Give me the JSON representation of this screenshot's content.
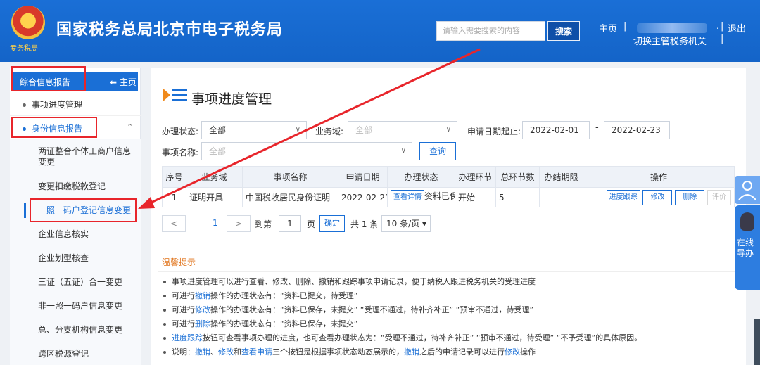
{
  "header": {
    "emblem_text": "专务税局",
    "title": "国家税务总局北京市电子税务局",
    "search_placeholder": "请输入需要搜索的内容",
    "search_button": "搜索",
    "home_link": "主页",
    "separator": "|",
    "dot": ".",
    "logout": "退出",
    "switch_authority": "切换主管税务机关"
  },
  "sidebar": {
    "section_title": "综合信息报告",
    "home_label": "主页",
    "items": [
      {
        "label": "事项进度管理"
      },
      {
        "label": "身份信息报告"
      }
    ],
    "subitems": [
      {
        "label": "两证整合个体工商户信息变更"
      },
      {
        "label": "变更扣缴税款登记"
      },
      {
        "label": "一照一码户登记信息变更"
      },
      {
        "label": "企业信息核实"
      },
      {
        "label": "企业划型核查"
      },
      {
        "label": "三证（五证）合一变更"
      },
      {
        "label": "非一照一码户信息变更"
      },
      {
        "label": "总、分支机构信息变更"
      },
      {
        "label": "跨区税源登记"
      }
    ]
  },
  "main": {
    "page_title": "事项进度管理",
    "filters": {
      "status_label": "办理状态:",
      "status_value": "全部",
      "domain_label": "业务域:",
      "domain_value": "全部",
      "date_label": "申请日期起止:",
      "date_from": "2022-02-01",
      "date_dash": "-",
      "date_to": "2022-02-23",
      "name_label": "事项名称:",
      "name_value": "全部",
      "query_button": "查询"
    },
    "table": {
      "headers": [
        "序号",
        "业务域",
        "事项名称",
        "申请日期",
        "办理状态",
        "办理环节",
        "总环节数",
        "办结期限",
        "操作"
      ],
      "rows": [
        {
          "index": "1",
          "domain": "证明开具",
          "name": "中国税收居民身份证明",
          "date": "2022-02-21",
          "detail_button": "查看详情",
          "status_text": "资料已保",
          "stage": "开始",
          "total_steps": "5",
          "deadline": "",
          "actions": [
            "进度跟踪",
            "修改",
            "删除",
            "评价"
          ]
        }
      ]
    },
    "pager": {
      "prev": "<",
      "current_page": "1",
      "next": ">",
      "goto_label": "到第",
      "goto_value": "1",
      "page_unit": "页",
      "confirm": "确定",
      "total": "共 1 条",
      "page_size": "10 条/页"
    },
    "tips": {
      "title": "温馨提示",
      "lines": [
        [
          "事项进度管理可以进行查看、修改、删除、撤销和跟踪事项申请记录，便于纳税人跟进税务机关的受理进度"
        ],
        [
          "可进行",
          "撤销",
          "操作的办理状态有：“资料已提交，待受理”"
        ],
        [
          "可进行",
          "修改",
          "操作的办理状态有：“资料已保存，未提交” “受理不通过，待补齐补正” “预审不通过，待受理”"
        ],
        [
          "可进行",
          "删除",
          "操作的办理状态有：“资料已保存，未提交”"
        ],
        [
          "进度跟踪",
          "按钮可查看事项办理的进度，也可查看办理状态为：“受理不通过，待补齐补正” “预审不通过，待受理” “不予受理”的具体原因。"
        ],
        [
          "说明：",
          "撤销",
          "、",
          "修改",
          "和",
          "查看申请",
          "三个按钮是根据事项状态动态展示的，",
          "撤销",
          "之后的申请记录可以进行",
          "修改",
          "操作"
        ]
      ]
    }
  },
  "float_widget": {
    "text": "在线导办"
  },
  "colors": {
    "brand_blue": "#1a6fd6",
    "annotation_red": "#e8252b",
    "tip_orange": "#e0731a"
  }
}
